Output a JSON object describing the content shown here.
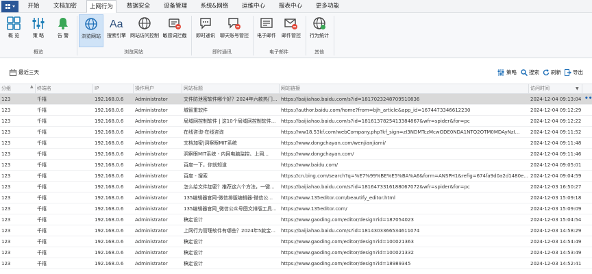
{
  "menubar": {
    "tabs": [
      {
        "label": "开始"
      },
      {
        "label": "文档加密"
      },
      {
        "label": "上网行为"
      },
      {
        "label": "数据安全"
      },
      {
        "label": "设备管理"
      },
      {
        "label": "系统&网络"
      },
      {
        "label": "运维中心"
      },
      {
        "label": "报表中心"
      },
      {
        "label": "更多功能"
      }
    ]
  },
  "ribbon": {
    "buttons": [
      {
        "label": "概 览",
        "icon": "grid-icon"
      },
      {
        "label": "策 略",
        "icon": "sliders-icon"
      },
      {
        "label": "告 警",
        "icon": "bell-icon"
      },
      {
        "label": "浏览网站",
        "icon": "globe-icon"
      },
      {
        "label": "搜索引擎",
        "icon": "font-aa-icon"
      },
      {
        "label": "网站访问控制",
        "icon": "globe-lock-icon"
      },
      {
        "label": "敏感词拦截",
        "icon": "shield-block-icon"
      },
      {
        "label": "即时通讯",
        "icon": "chat-icon"
      },
      {
        "label": "聊天账号管控",
        "icon": "chat-lock-icon"
      },
      {
        "label": "电子邮件",
        "icon": "mail-icon"
      },
      {
        "label": "邮件管控",
        "icon": "mail-lock-icon"
      },
      {
        "label": "行为统计",
        "icon": "globe-chart-icon"
      }
    ],
    "groups": [
      {
        "label": "概览"
      },
      {
        "label": "浏览网站"
      },
      {
        "label": "即时通讯"
      },
      {
        "label": "电子邮件"
      },
      {
        "label": "其他"
      }
    ]
  },
  "toolbar": {
    "date_range": "最近三天",
    "strategy": "策略",
    "search": "搜索",
    "refresh": "刷新",
    "export": "导出"
  },
  "table": {
    "columns": [
      "分组",
      "终端名",
      "IP",
      "操作用户",
      "网站标题",
      "网站链接",
      "访问时间"
    ],
    "rows": [
      [
        "123",
        "千禧",
        "192.168.0.6",
        "Administrator",
        "文件防泄密软件哪个好？2024年六款热门...",
        "https://baijiahao.baidu.com/s?id=1817023248709510836",
        "2024-12-04 09:13:04"
      ],
      [
        "123",
        "千禧",
        "192.168.0.6",
        "Administrator",
        "城智重软件",
        "https://author.baidu.com/home?from=bjh_article&app_id=1674473346612230",
        "2024-12-04 09:12:29"
      ],
      [
        "123",
        "千禧",
        "192.168.0.6",
        "Administrator",
        "局域网控制软件 | 这10个局域网控制软件...",
        "https://baijiahao.baidu.com/s?id=1816137825413384867&wfr=spider&for=pc",
        "2024-12-04 09:12:22"
      ],
      [
        "123",
        "千禧",
        "192.168.0.6",
        "Administrator",
        "在线咨询-在线咨询",
        "https://ww18.53kf.com/webCompany.php?kf_sign=zI3NDMTczMcwODE0NDA1NTQ2OTM0MDAyNzI...",
        "2024-12-04 09:11:52"
      ],
      [
        "123",
        "千禧",
        "192.168.0.6",
        "Administrator",
        "文档加密|洞察眼MIT系统",
        "https://www.dongchayan.com/wenjianjiami/",
        "2024-12-04 09:11:48"
      ],
      [
        "123",
        "千禧",
        "192.168.0.6",
        "Administrator",
        "洞察眼MIT系统 - 内网电脑监控、上网...",
        "https://www.dongchayan.com/",
        "2024-12-04 09:11:46"
      ],
      [
        "123",
        "千禧",
        "192.168.0.6",
        "Administrator",
        "百度一下，你就知道",
        "https://www.baidu.com/",
        "2024-12-04 09:05:01"
      ],
      [
        "123",
        "千禧",
        "192.168.0.6",
        "Administrator",
        "百度 - 搜索",
        "https://cn.bing.com/search?q=%E7%99%BE%E5%BA%A6&form=ANSPH1&refig=674fa9d0a2d1480e...",
        "2024-12-04 09:04:59"
      ],
      [
        "123",
        "千禧",
        "192.168.0.6",
        "Administrator",
        "怎么给文件加密？推荐这六个方法，一键...",
        "https://baijiahao.baidu.com/s?id=1816473316188067072&wfr=spider&for=pc",
        "2024-12-03 16:50:27"
      ],
      [
        "123",
        "千禧",
        "192.168.0.6",
        "Administrator",
        "135编辑器官网-微信排版编辑器-微信公...",
        "https://www.135editor.com/beautify_editor.html",
        "2024-12-03 15:09:18"
      ],
      [
        "123",
        "千禧",
        "192.168.0.6",
        "Administrator",
        "135编辑器官网_微信公众号图文排版工具...",
        "https://www.135editor.com/",
        "2024-12-03 15:09:09"
      ],
      [
        "123",
        "千禧",
        "192.168.0.6",
        "Administrator",
        "稿定设计",
        "https://www.gaoding.com/editor/design?id=187054023",
        "2024-12-03 15:04:54"
      ],
      [
        "123",
        "千禧",
        "192.168.0.6",
        "Administrator",
        "上网行为管理软件有哪些？2024年5款宝...",
        "https://baijiahao.baidu.com/s?id=1814303366534611074",
        "2024-12-03 14:58:29"
      ],
      [
        "123",
        "千禧",
        "192.168.0.6",
        "Administrator",
        "稿定设计",
        "https://www.gaoding.com/editor/design?id=100021363",
        "2024-12-03 14:54:49"
      ],
      [
        "123",
        "千禧",
        "192.168.0.6",
        "Administrator",
        "稿定设计",
        "https://www.gaoding.com/editor/design?id=100021332",
        "2024-12-03 14:53:49"
      ],
      [
        "123",
        "千禧",
        "192.168.0.6",
        "Administrator",
        "稿定设计",
        "https://www.gaoding.com/editor/design?id=18989345",
        "2024-12-03 14:52:41"
      ]
    ]
  },
  "colors": {
    "accent": "#2b5797",
    "selected_row": "#d9d9d9",
    "active_ribbon": "#cfe3f7"
  }
}
